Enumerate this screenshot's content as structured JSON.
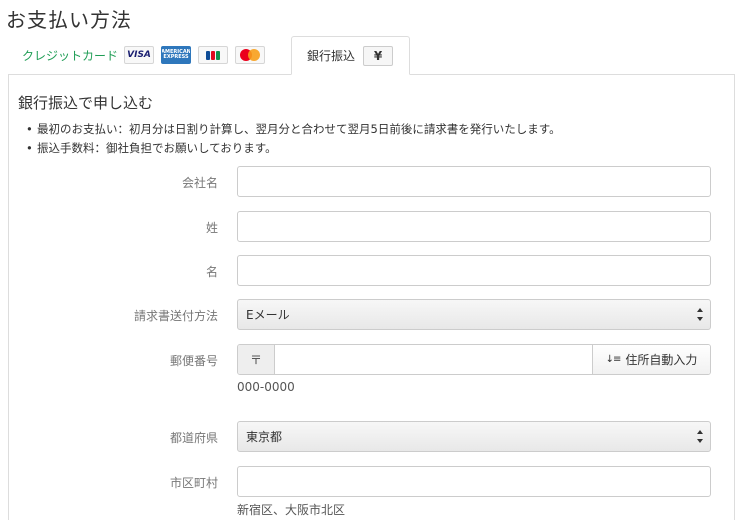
{
  "page": {
    "title": "お支払い方法"
  },
  "tabs": {
    "card": {
      "label": "クレジットカード",
      "brands": {
        "visa": "VISA",
        "amex_top": "AMERICAN",
        "amex_bottom": "EXPRESS"
      },
      "colors": {
        "label": "#1f9d55",
        "jcb": [
          "#0e4c96",
          "#e20a1d",
          "#11914b"
        ]
      }
    },
    "bank": {
      "label": "銀行振込",
      "icon_text": "¥"
    }
  },
  "section": {
    "title": "銀行振込で申し込む",
    "notes": [
      "最初のお支払い：初月分は日割り計算し、翌月分と合わせて翌月5日前後に請求書を発行いたします。",
      "振込手数料：御社負担でお願いしております。"
    ]
  },
  "form": {
    "company": {
      "label": "会社名",
      "value": ""
    },
    "last_name": {
      "label": "姓",
      "value": ""
    },
    "first_name": {
      "label": "名",
      "value": ""
    },
    "invoice_method": {
      "label": "請求書送付方法",
      "selected": "Eメール"
    },
    "postal": {
      "label": "郵便番号",
      "prefix": "〒",
      "value": "",
      "button": "住所自動入力",
      "button_icon": "sort-icon",
      "hint": "000-0000"
    },
    "prefecture": {
      "label": "都道府県",
      "selected": "東京都"
    },
    "city": {
      "label": "市区町村",
      "value": "",
      "hint": "新宿区、大阪市北区"
    }
  }
}
